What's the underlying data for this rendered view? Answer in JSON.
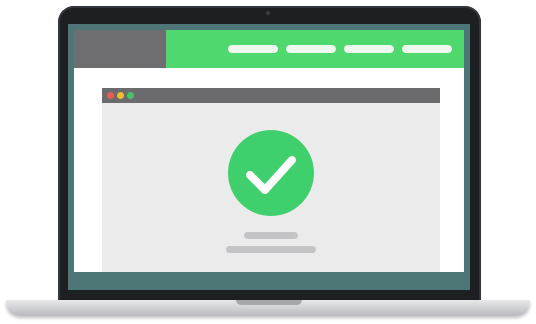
{
  "scene": {
    "device": "laptop",
    "bezel_color": "#1d1f22",
    "screen_border_color": "#4e7676",
    "base_color": "#d4d5d7"
  },
  "site": {
    "header_color": "#4ed86d",
    "logo_block_color": "#6e6e70",
    "nav_items": [
      "nav-pill",
      "nav-pill",
      "nav-pill",
      "nav-pill"
    ],
    "nav_pill_color": "#eef8ef",
    "background": "#ffffff"
  },
  "browser": {
    "window_bg": "#ebebec",
    "titlebar_color": "#6b6b6e",
    "traffic_lights": [
      "#ec5b52",
      "#f2be2e",
      "#47c46a"
    ]
  },
  "status": {
    "icon": "checkmark-icon",
    "circle_color": "#3fd06d",
    "placeholder_line_color": "#c4c4c6"
  }
}
